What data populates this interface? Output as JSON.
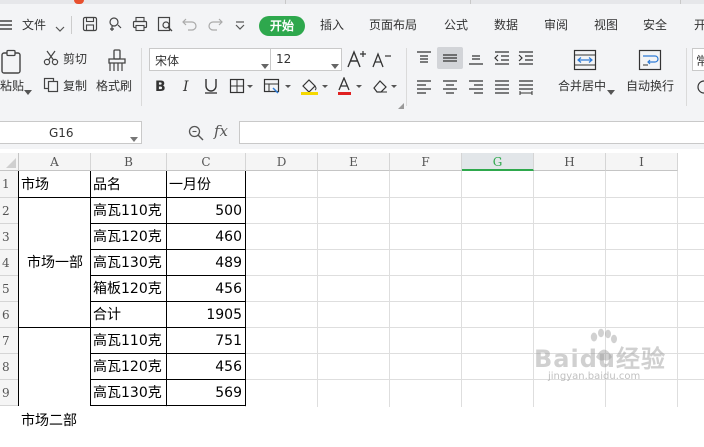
{
  "menubar": {
    "file_label": "文件",
    "tabs": [
      "开始",
      "插入",
      "页面布局",
      "公式",
      "数据",
      "审阅",
      "视图",
      "安全",
      "开"
    ]
  },
  "ribbon": {
    "paste": "粘贴",
    "cut": "剪切",
    "copy": "复制",
    "format_painter": "格式刷",
    "font_name": "宋体",
    "font_size": "12",
    "merge_center": "合并居中",
    "wrap_text": "自动换行",
    "cut_off_right": "常"
  },
  "formula_bar": {
    "name_box": "G16",
    "fx": "fx",
    "formula": ""
  },
  "columns": [
    "A",
    "B",
    "C",
    "D",
    "E",
    "F",
    "G",
    "H",
    "I"
  ],
  "selected_column": "G",
  "rows": [
    "1",
    "2",
    "3",
    "4",
    "5",
    "6",
    "7",
    "8",
    "9"
  ],
  "sheet": {
    "header": [
      "市场",
      "品名",
      "一月份"
    ],
    "market1": "市场一部",
    "market2": "市场二部",
    "items": [
      {
        "name": "高瓦110克",
        "value": "500"
      },
      {
        "name": "高瓦120克",
        "value": "460"
      },
      {
        "name": "高瓦130克",
        "value": "489"
      },
      {
        "name": "箱板120克",
        "value": "456"
      },
      {
        "name": "合计",
        "value": "1905"
      },
      {
        "name": "高瓦110克",
        "value": "751"
      },
      {
        "name": "高瓦120克",
        "value": "456"
      },
      {
        "name": "高瓦130克",
        "value": "569"
      }
    ]
  },
  "watermark": {
    "logo": "Baidu经验",
    "url": "jingyan.baidu.com"
  },
  "colors": {
    "accent_green": "#2ea84d",
    "toolbar_bg": "#f3f4f6"
  }
}
